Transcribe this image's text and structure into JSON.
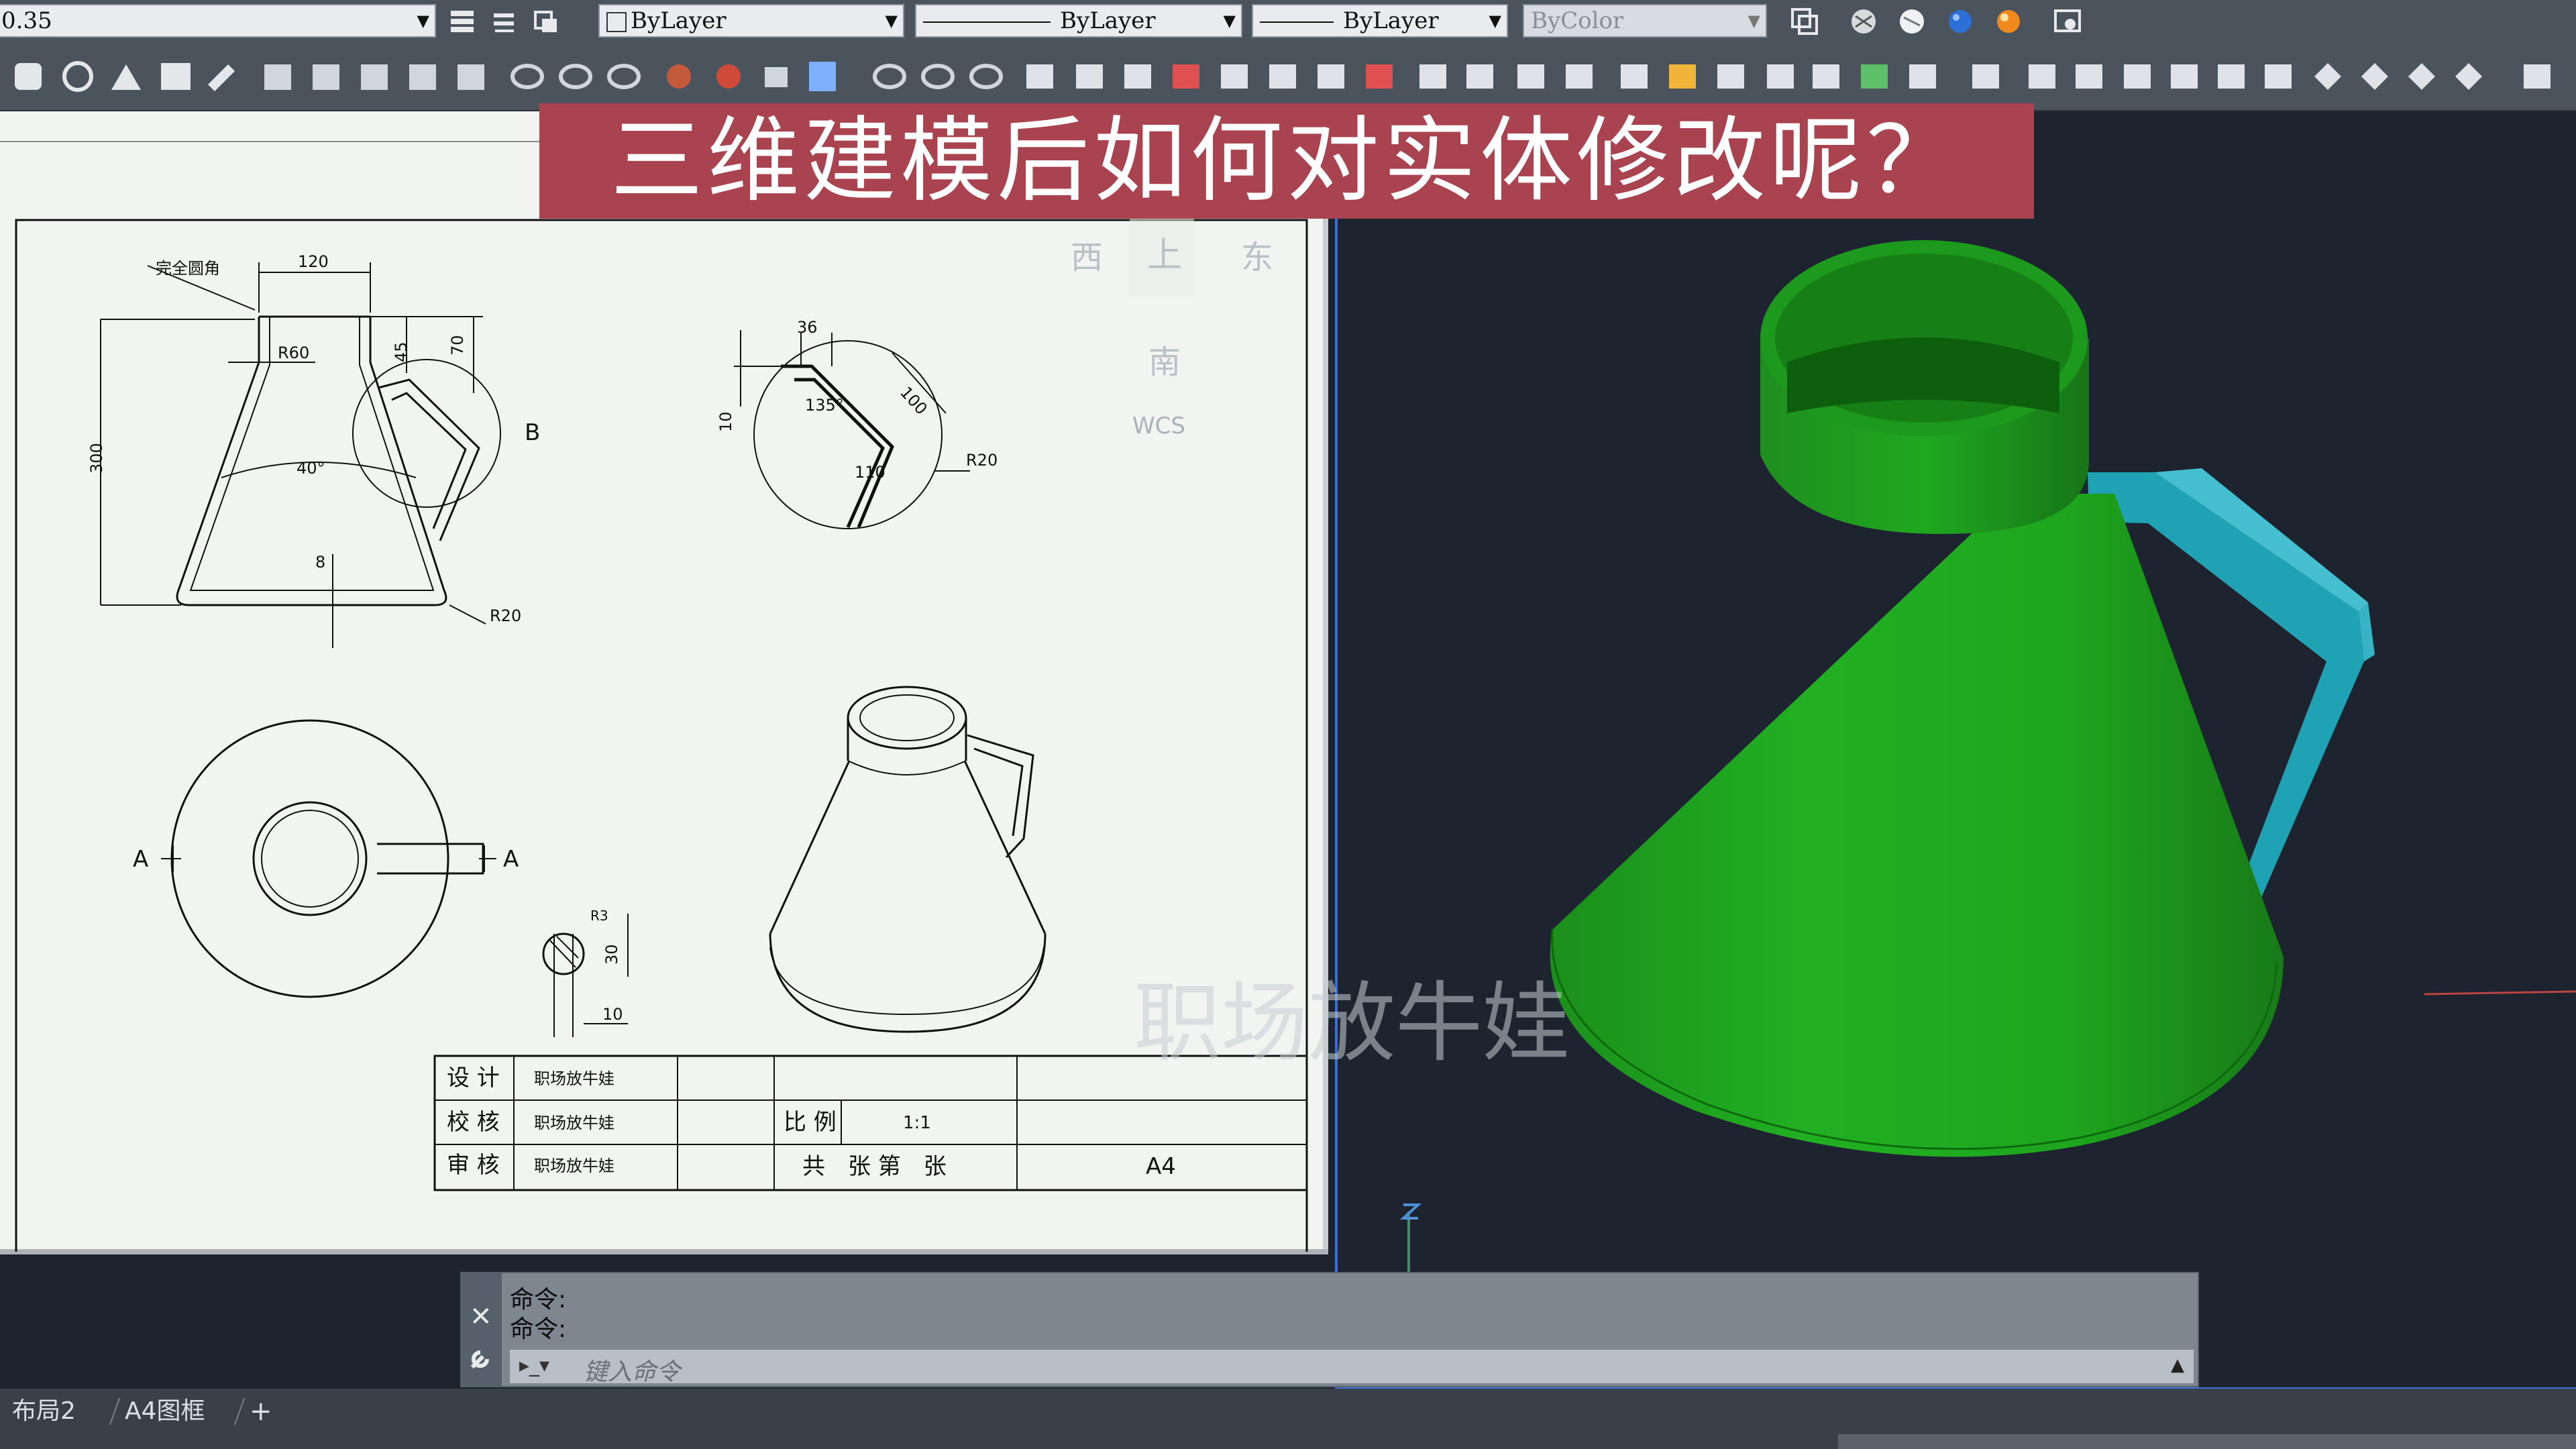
{
  "toolbar": {
    "lineweight_value": "0.35",
    "layer_combo": "ByLayer",
    "linetype_combo": "ByLayer",
    "lineweight_combo": "ByLayer",
    "color_combo": "ByColor"
  },
  "banner": {
    "title": "三维建模后如何对实体修改呢？"
  },
  "viewcube": {
    "west": "西",
    "top": "上",
    "east": "东",
    "south": "南",
    "wcs": "WCS"
  },
  "drawing": {
    "dims": {
      "note_fillet": "完全圆角",
      "d120": "120",
      "r60": "R60",
      "d45": "45",
      "d70": "70",
      "d300": "300",
      "d40deg": "40°",
      "d8": "8",
      "r20_main": "R20",
      "detail_b": "B",
      "d36": "36",
      "d100": "100",
      "d135": "135°",
      "d10": "10",
      "d110": "110",
      "r20_detail": "R20",
      "section_a_left": "A",
      "section_a_right": "A",
      "r3": "R3",
      "d30": "30",
      "d10_small": "10"
    },
    "title_block": {
      "design_label": "设 计",
      "check_label": "校 核",
      "review_label": "审 核",
      "design_name": "职场放牛娃",
      "check_name": "职场放牛娃",
      "review_name": "职场放牛娃",
      "scale_label": "比 例",
      "scale_value": "1:1",
      "sheet_label": "共　张 第　张",
      "paper_size": "A4"
    }
  },
  "watermark": "职场放牛娃",
  "command": {
    "line1": "命令:",
    "line2": "命令:",
    "placeholder": "键入命令"
  },
  "tabs": [
    "布局2",
    "A4图框"
  ],
  "add_tab": "+",
  "colors": {
    "toolbar": "#4b535d",
    "banner": "#a8434f",
    "model_body": "#1f9e1f",
    "model_handle": "#1fa7b8",
    "viewport_bg": "#1d2430",
    "viewport_frame": "#3b6ed8"
  },
  "icons": [
    "layer-properties-icon",
    "layer-state-icon",
    "match-layer-icon",
    "box-icon",
    "sphere-icon",
    "cone-icon",
    "union-icon",
    "subtract-icon",
    "intersect-icon",
    "render-icon",
    "material-icon",
    "light-icon"
  ]
}
